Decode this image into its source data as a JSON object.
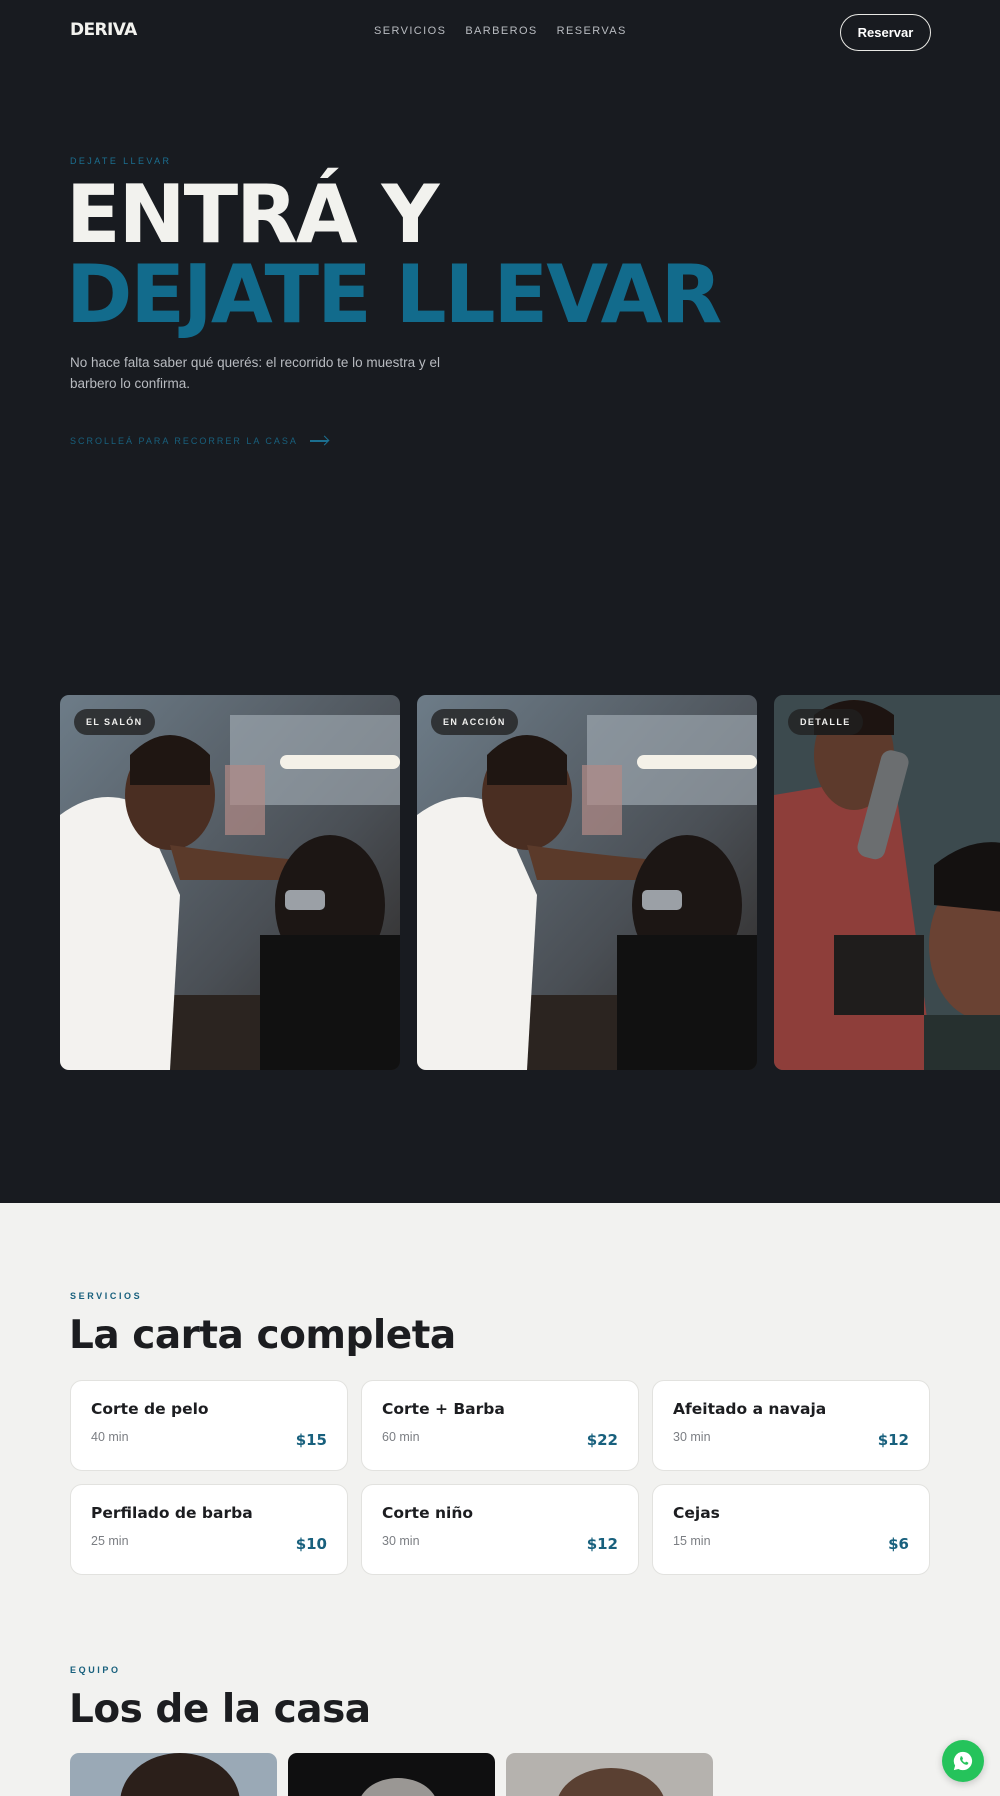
{
  "nav": {
    "logo": "DERIVA",
    "links": [
      "SERVICIOS",
      "BARBEROS",
      "RESERVAS"
    ],
    "cta": "Reservar"
  },
  "hero": {
    "eyebrow": "DEJATE LLEVAR",
    "title_line1": "ENTRÁ Y",
    "title_line2": "DEJATE LLEVAR",
    "description": "No hace falta saber qué querés: el recorrido te lo muestra y el barbero lo confirma.",
    "scroll_hint": "SCROLLEÁ PARA RECORRER LA CASA"
  },
  "gallery": [
    {
      "tag": "EL SALÓN"
    },
    {
      "tag": "EN ACCIÓN"
    },
    {
      "tag": "DETALLE"
    }
  ],
  "services": {
    "eyebrow": "SERVICIOS",
    "title": "La carta completa",
    "items": [
      {
        "name": "Corte de pelo",
        "duration": "40 min",
        "price": "$15"
      },
      {
        "name": "Corte + Barba",
        "duration": "60 min",
        "price": "$22"
      },
      {
        "name": "Afeitado a navaja",
        "duration": "30 min",
        "price": "$12"
      },
      {
        "name": "Perfilado de barba",
        "duration": "25 min",
        "price": "$10"
      },
      {
        "name": "Corte niño",
        "duration": "30 min",
        "price": "$12"
      },
      {
        "name": "Cejas",
        "duration": "15 min",
        "price": "$6"
      }
    ]
  },
  "team": {
    "eyebrow": "EQUIPO",
    "title": "Los de la casa"
  },
  "colors": {
    "hero_bg": "#181b20",
    "accent": "#126b8c",
    "page_bg": "#f2f2f0",
    "whatsapp": "#25c35b"
  },
  "icons": {
    "scroll_arrow": "arrow-right-icon",
    "whatsapp": "whatsapp-icon"
  }
}
